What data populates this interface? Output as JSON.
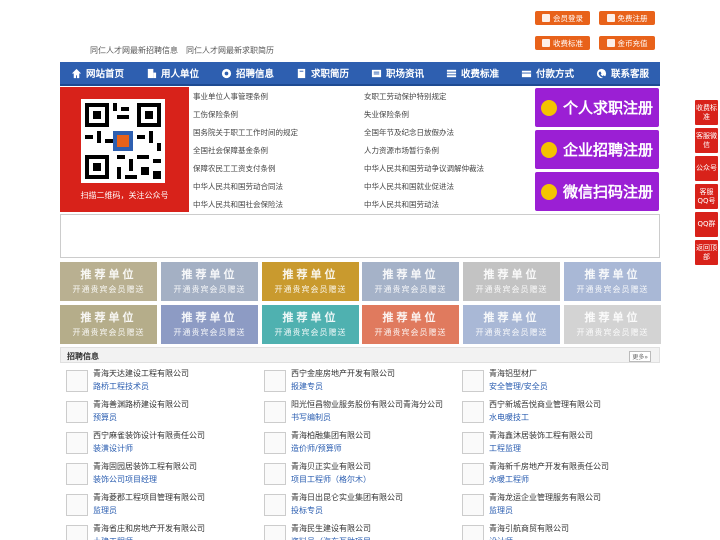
{
  "header": {
    "links": [
      "同仁人才网最新招聘信息",
      "同仁人才网最新求职简历"
    ],
    "buttons": {
      "member_login": "会员登录",
      "free_register": "免费注册",
      "fee_standard": "收费标准",
      "coin_recharge": "金币充值"
    }
  },
  "nav": {
    "items": [
      "网站首页",
      "用人单位",
      "招聘信息",
      "求职简历",
      "职场资讯",
      "收费标准",
      "付款方式",
      "联系客服"
    ]
  },
  "qr": {
    "caption": "扫描二维码，关注公众号"
  },
  "news": {
    "left": [
      "事业单位人事管理条例",
      "工伤保险条例",
      "国务院关于职工工作时间的规定",
      "全国社会保障基金条例",
      "保障农民工工资支付条例",
      "中华人民共和国劳动合同法",
      "中华人民共和国社会保险法"
    ],
    "right": [
      "女职工劳动保护特别规定",
      "失业保险条例",
      "全国年节及纪念日放假办法",
      "人力资源市场暂行条例",
      "中华人民共和国劳动争议调解仲裁法",
      "中华人民共和国就业促进法",
      "中华人民共和国劳动法"
    ]
  },
  "register": {
    "personal": "个人求职注册",
    "company": "企业招聘注册",
    "wechat": "微信扫码注册"
  },
  "tiles": {
    "title": "推荐单位",
    "subtitle": "开通贵宾会员赠送",
    "colors": [
      "#b9b091",
      "#a4b0c4",
      "#c99a2e",
      "#a5b2c8",
      "#c3c3c3",
      "#a9b8d6",
      "#b5ad8a",
      "#8d9bc4",
      "#4fb1b0",
      "#e07a5e",
      "#a9b8d6",
      "#d3d3d3"
    ]
  },
  "jobs": {
    "title": "招聘信息",
    "more": "更多»",
    "rows": [
      [
        {
          "company": "青海天达建设工程有限公司",
          "position": "路桥工程技术员"
        },
        {
          "company": "西宁金座房地产开发有限公司",
          "position": "报建专员"
        },
        {
          "company": "青海铝型材厂",
          "position": "安全管理/安全员"
        }
      ],
      [
        {
          "company": "青海善渊路桥建设有限公司",
          "position": "预算员"
        },
        {
          "company": "阳光恒昌物业服务股份有限公司青海分公司",
          "position": "书写编制员"
        },
        {
          "company": "西宁新城吾悦商业管理有限公司",
          "position": "水电暖技工"
        }
      ],
      [
        {
          "company": "西宁麻雀装饰设计有限责任公司",
          "position": "装潢设计师"
        },
        {
          "company": "青海柏融集团有限公司",
          "position": "造价师/预算师"
        },
        {
          "company": "青海鑫沐居装饰工程有限公司",
          "position": "工程监理"
        }
      ],
      [
        {
          "company": "青海固园居装饰工程有限公司",
          "position": "装饰公司项目经理"
        },
        {
          "company": "青海贝正实业有限公司",
          "position": "项目工程师（格尔木）"
        },
        {
          "company": "青海新千房地产开发有限责任公司",
          "position": "水暖工程师"
        }
      ],
      [
        {
          "company": "青海菱郡工程项目管理有限公司",
          "position": "监理员"
        },
        {
          "company": "青海日出昆仑实业集团有限公司",
          "position": "投标专员"
        },
        {
          "company": "青海龙运企业管理服务有限公司",
          "position": "监理员"
        }
      ],
      [
        {
          "company": "青海省庄和房地产开发有限公司",
          "position": "土建工程师"
        },
        {
          "company": "青海民生建设有限公司",
          "position": "资料员（海东互助项目"
        },
        {
          "company": "青海引航商贸有限公司",
          "position": "设计师"
        }
      ]
    ]
  },
  "sidebar": [
    "收费标准",
    "客服微信",
    "公众号",
    "客服QQ号",
    "QQ群",
    "返回顶部"
  ],
  "colors": {
    "nav": "#2e5fb0",
    "accent": "#e8621a",
    "register": "#9b1fd4",
    "qr_bg": "#d8221a"
  }
}
